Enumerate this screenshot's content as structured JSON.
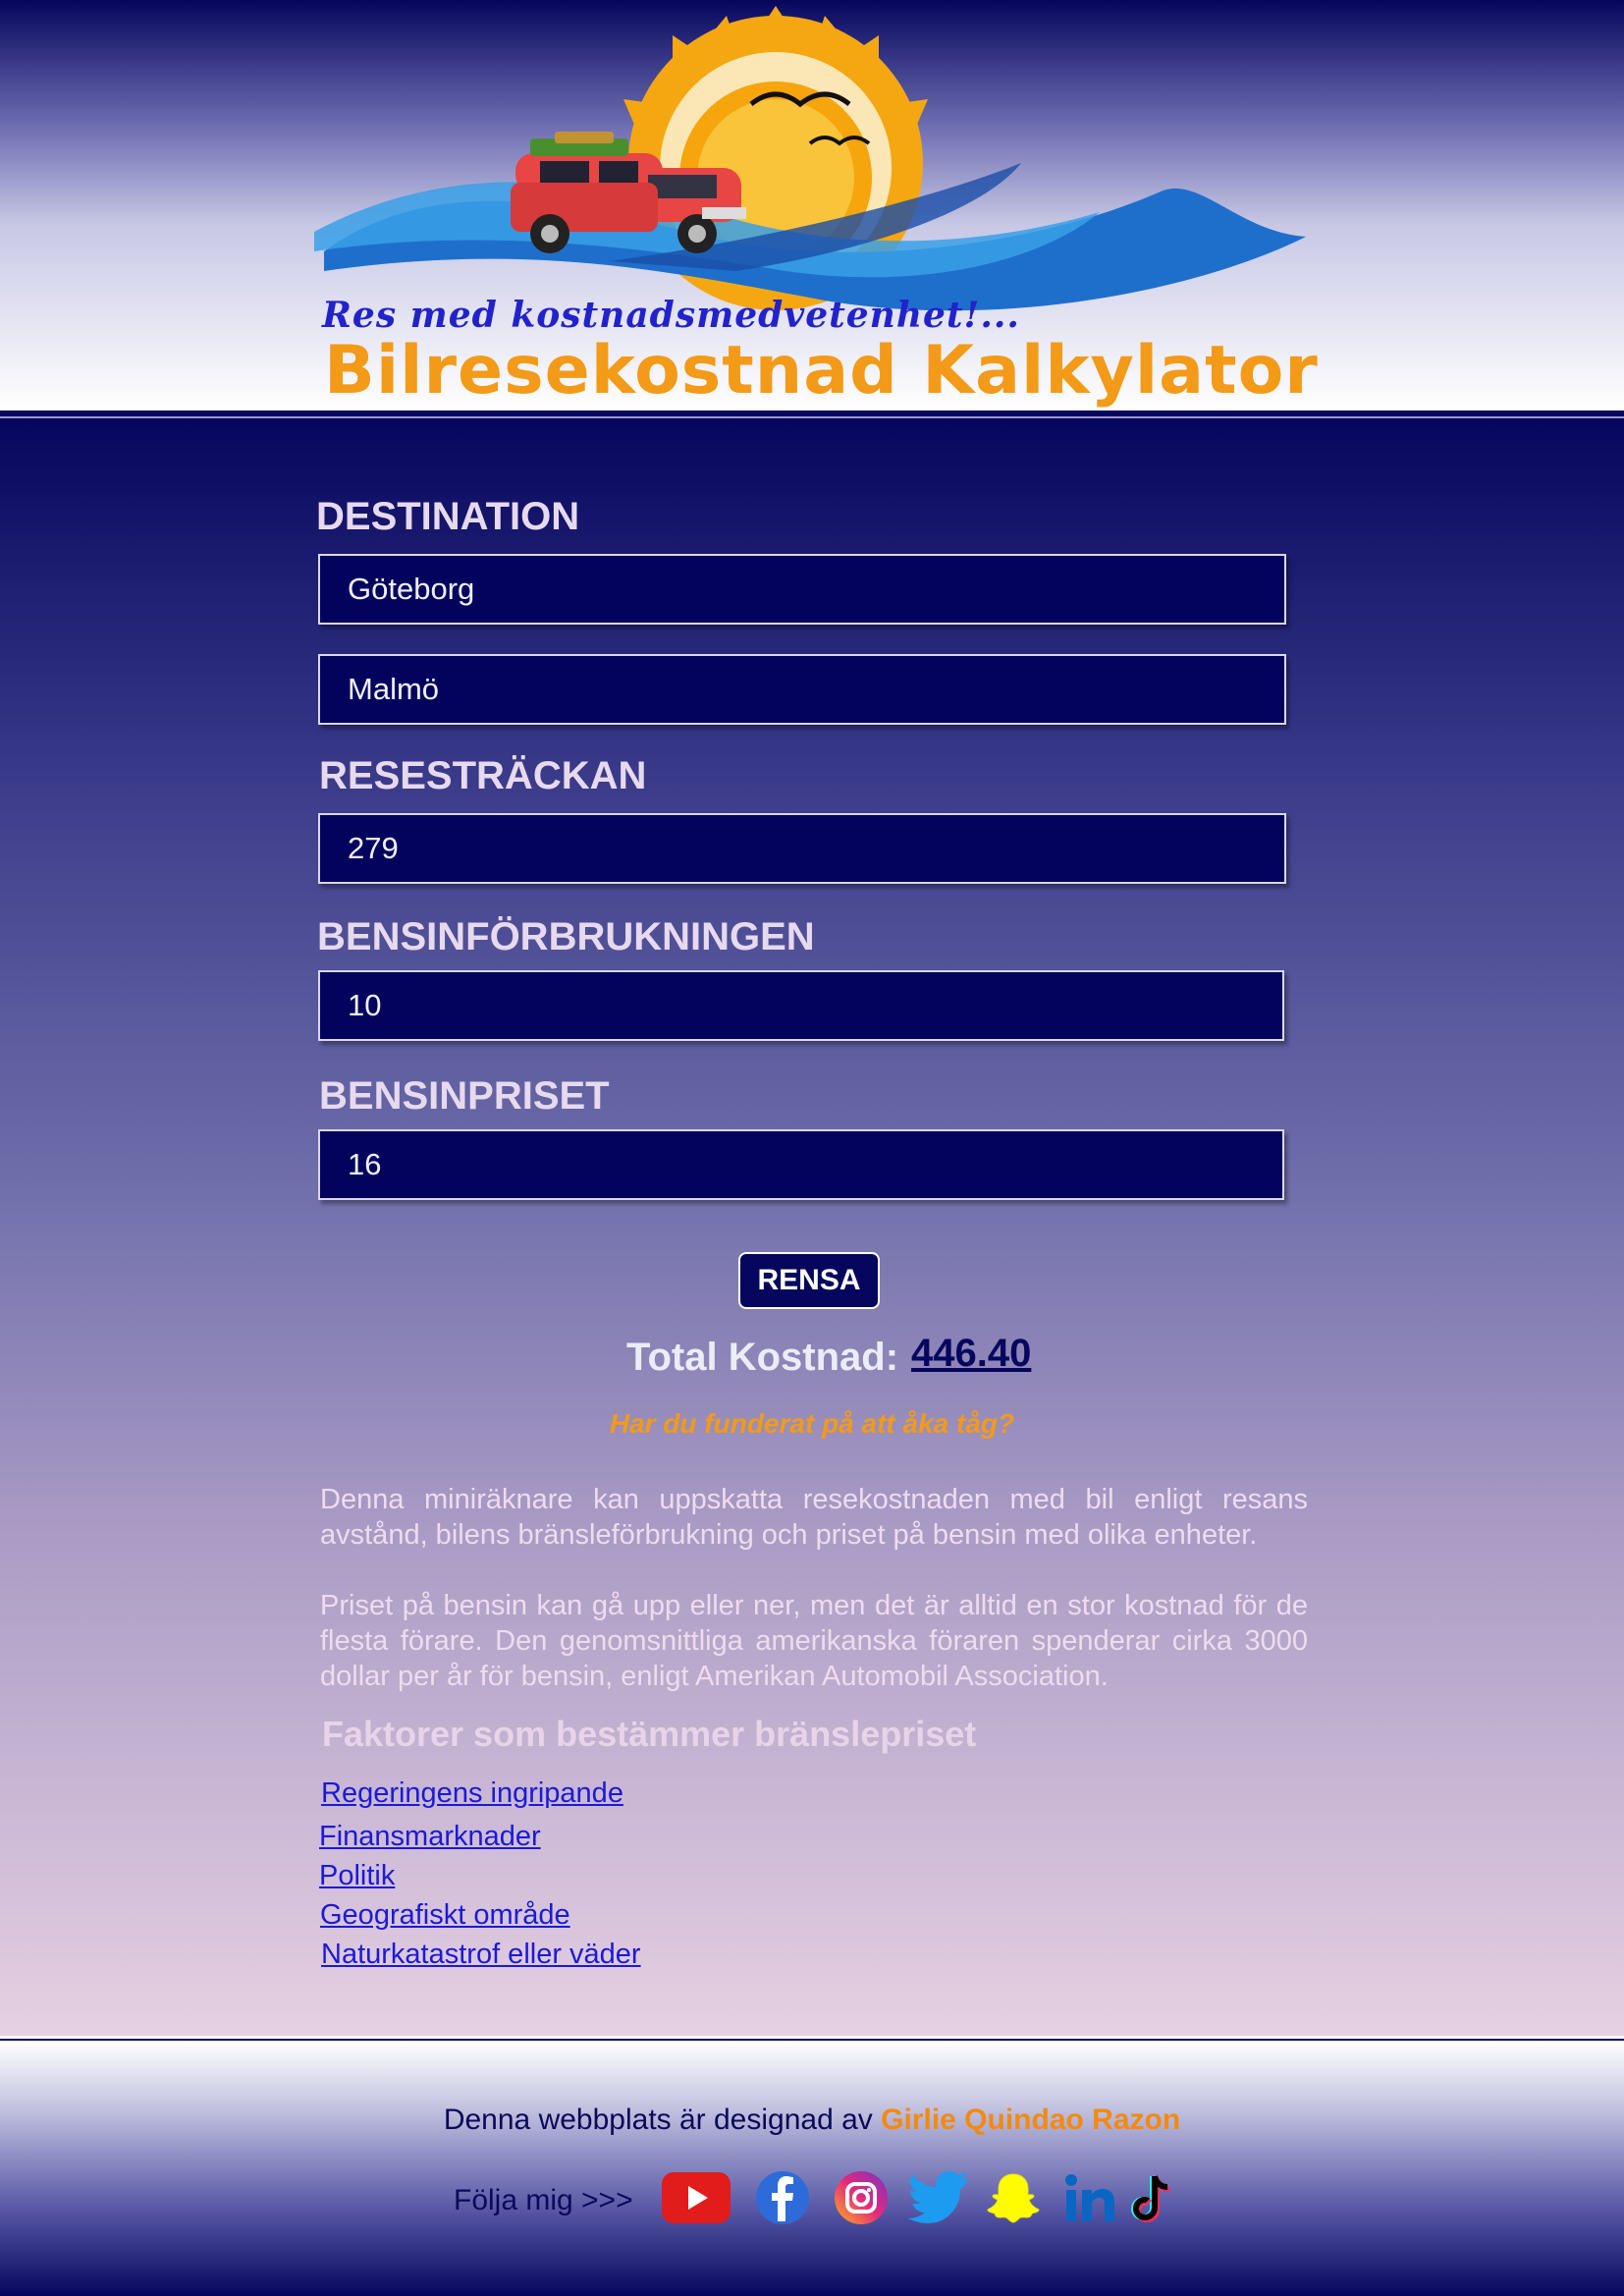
{
  "header": {
    "tagline": "Res med kostnadsmedvetenhet!...",
    "brand": "Bilresekostnad Kalkylator"
  },
  "form": {
    "destination_label": "DESTINATION",
    "from_value": "Göteborg",
    "to_value": "Malmö",
    "distance_label": "RESESTRÄCKAN",
    "distance_value": "279",
    "consumption_label": "BENSINFÖRBRUKNINGEN",
    "consumption_value": "10",
    "price_label": "BENSINPRISET",
    "price_value": "16",
    "clear_button": "RENSA"
  },
  "result": {
    "total_label": "Total Kostnad:",
    "total_value": "446.40",
    "train_question": "Har du funderat på att åka tåg?"
  },
  "content": {
    "paragraph1": "Denna miniräknare kan uppskatta resekostnaden med bil enligt resans avstånd, bilens bränsleförbrukning och priset på bensin med olika enheter.",
    "paragraph2": "Priset på bensin kan gå upp eller ner, men det är alltid en stor kostnad för de flesta förare. Den genomsnittliga amerikanska föraren spenderar cirka 3000 dollar per år för bensin, enligt Amerikan Automobil Association.",
    "factors_heading": "Faktorer som bestämmer bränslepriset",
    "links": [
      "Regeringens ingripande",
      "Finansmarknader",
      "Politik",
      "Geografiskt område",
      "Naturkatastrof eller väder"
    ]
  },
  "footer": {
    "credit_prefix": "Denna webbplats är designad av",
    "credit_name": "Girlie Quindao Razon",
    "follow_label": "Följa mig >>>",
    "social_icons": [
      "youtube-icon",
      "facebook-icon",
      "instagram-icon",
      "twitter-icon",
      "snapchat-icon",
      "linkedin-icon",
      "tiktok-icon"
    ]
  },
  "colors": {
    "navy": "#06065e",
    "accent_orange": "#f39a18",
    "link_blue": "#1a1ad8"
  }
}
